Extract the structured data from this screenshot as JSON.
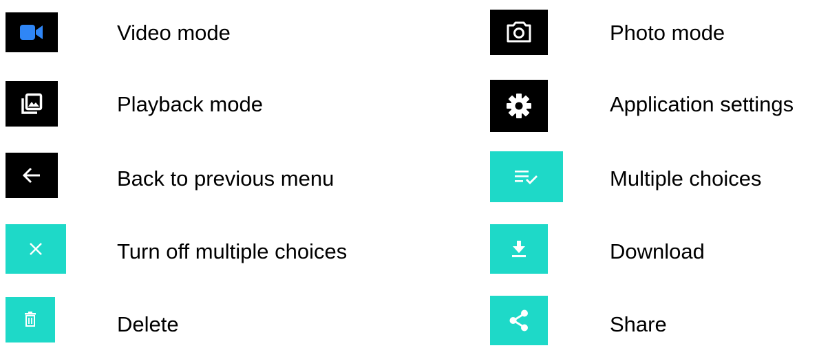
{
  "colors": {
    "dark_tile": "#000000",
    "teal_tile": "#1ed9c8",
    "video_icon": "#2f86f6",
    "icon_on_dark": "#ffffff",
    "icon_on_teal": "#ffffff"
  },
  "left_column": [
    {
      "icon": "video-camera-icon",
      "label": "Video mode"
    },
    {
      "icon": "photo-library-icon",
      "label": "Playback mode"
    },
    {
      "icon": "arrow-back-icon",
      "label": "Back to previous menu"
    },
    {
      "icon": "close-icon",
      "label": "Turn off multiple choices"
    },
    {
      "icon": "trash-icon",
      "label": "Delete"
    }
  ],
  "right_column": [
    {
      "icon": "camera-icon",
      "label": "Photo mode"
    },
    {
      "icon": "gear-icon",
      "label": "Application settings"
    },
    {
      "icon": "checklist-icon",
      "label": "Multiple choices"
    },
    {
      "icon": "download-icon",
      "label": "Download"
    },
    {
      "icon": "share-icon",
      "label": "Share"
    }
  ]
}
